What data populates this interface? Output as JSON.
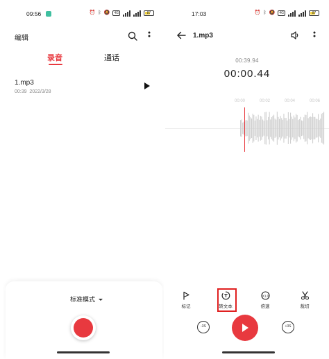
{
  "left": {
    "status": {
      "time": "09:56",
      "network": "4G",
      "battery": "87"
    },
    "header": {
      "title": "编辑"
    },
    "tabs": [
      {
        "label": "录音",
        "active": true
      },
      {
        "label": "通话",
        "active": false
      }
    ],
    "recordings": [
      {
        "name": "1.mp3",
        "duration": "00:39",
        "date": "2022/3/28"
      }
    ],
    "mode": {
      "label": "标准模式"
    }
  },
  "right": {
    "status": {
      "time": "17:03",
      "network": "4G",
      "battery": "87"
    },
    "header": {
      "title": "1.mp3"
    },
    "player": {
      "total_time": "00:39.94",
      "current_time": "00:00.44",
      "ruler_labels": [
        "00:00",
        "00:02",
        "00:04",
        "00:06"
      ]
    },
    "tools": [
      {
        "label": "标记",
        "icon": "flag-icon"
      },
      {
        "label": "转文本",
        "icon": "transcribe-icon"
      },
      {
        "label": "倍速",
        "icon": "speed-icon"
      },
      {
        "label": "裁切",
        "icon": "scissors-icon"
      }
    ],
    "speed_badge": "X1.0",
    "skip_back_label": "-3S",
    "skip_forward_label": "+3S"
  },
  "colors": {
    "accent": "#e8393f",
    "highlight_box": "#e02020",
    "waveform": "#cfcfcf"
  }
}
